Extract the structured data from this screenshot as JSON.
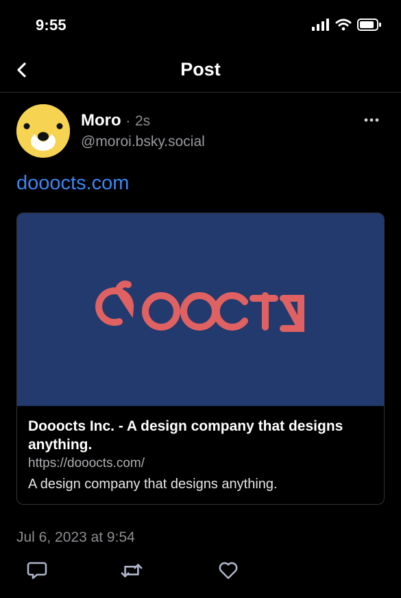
{
  "status": {
    "time": "9:55"
  },
  "nav": {
    "title": "Post"
  },
  "post": {
    "author_name": "Moro",
    "separator": "·",
    "time_ago": "2s",
    "handle": "@moroi.bsky.social",
    "link_text": "dooocts.com"
  },
  "card": {
    "logo_text": "dooctz",
    "title": "Dooocts Inc. - A design company that designs anything.",
    "url": "https://dooocts.com/",
    "description": "A design company that designs anything."
  },
  "meta": {
    "date": "Jul 6, 2023 at 9:54"
  },
  "colors": {
    "link": "#3d86f4",
    "card_bg": "#233a6e",
    "logo": "#e06161",
    "avatar": "#f6d452"
  }
}
